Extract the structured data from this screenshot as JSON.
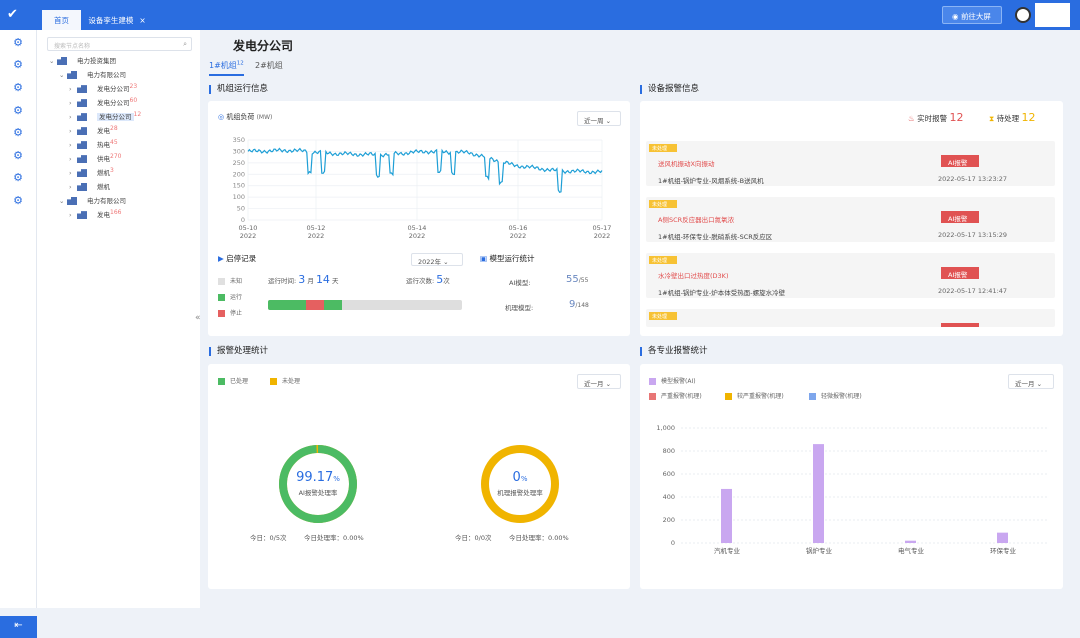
{
  "header": {
    "tabs": [
      {
        "label": "首页"
      },
      {
        "label": "设备孪生建模"
      }
    ],
    "big_screen_label": "前往大屏"
  },
  "tree": {
    "search_placeholder": "搜索节点名称",
    "nodes": [
      {
        "label": "电力投资集团"
      },
      {
        "label": "电力有限公司"
      },
      {
        "label": "发电分公司",
        "count": "23"
      },
      {
        "label": "发电分公司",
        "count": "60"
      },
      {
        "label": "发电分公司",
        "count": "12"
      },
      {
        "label": "发电",
        "count": "28"
      },
      {
        "label": "热电",
        "count": "45"
      },
      {
        "label": "供电",
        "count": "270"
      },
      {
        "label": "燃机",
        "count": "3"
      },
      {
        "label": "燃机",
        "count": ""
      },
      {
        "label": "电力有限公司"
      },
      {
        "label": "发电",
        "count": "166"
      }
    ]
  },
  "page": {
    "title": "发电分公司",
    "unit_tabs": [
      {
        "label": "1#机组",
        "count": "12"
      },
      {
        "label": "2#机组",
        "count": ""
      }
    ]
  },
  "unit_info": {
    "section_title": "机组运行信息",
    "load_label": "机组负荷",
    "load_unit": "(MW)",
    "period_select": "近一周",
    "y_ticks": [
      "350",
      "300",
      "250",
      "200",
      "150",
      "100",
      "50",
      "0"
    ],
    "x_ticks": [
      {
        "date": "05-10",
        "year": "2022"
      },
      {
        "date": "05-12",
        "year": "2022"
      },
      {
        "date": "05-14",
        "year": "2022"
      },
      {
        "date": "05-16",
        "year": "2022"
      },
      {
        "date": "05-17",
        "year": "2022"
      }
    ],
    "startstop": {
      "title": "启停记录",
      "year_select": "2022年",
      "legend": [
        {
          "label": "未知",
          "color": "#e0e0e0"
        },
        {
          "label": "运行",
          "color": "#4cbb63"
        },
        {
          "label": "停止",
          "color": "#e56060"
        }
      ],
      "run_time_label": "运行时间:",
      "run_months": "3",
      "month_unit": "月",
      "run_days": "14",
      "day_unit": "天",
      "run_count_label": "运行次数:",
      "run_count": "5",
      "count_unit": "次"
    },
    "model_stats": {
      "title": "模型运行统计",
      "ai_label": "AI模型:",
      "ai_value": "55",
      "ai_total": "/55",
      "mech_label": "机理模型:",
      "mech_value": "9",
      "mech_total": "/148"
    }
  },
  "alarm_info": {
    "section_title": "设备报警信息",
    "realtime_label": "实时报警",
    "realtime_count": "12",
    "pending_label": "待处理",
    "pending_count": "12",
    "items": [
      {
        "tag": "未处理",
        "title": "送风机振动X向振动",
        "button": "AI报警",
        "path": "1#机组-锅炉专业-风烟系统-B送风机",
        "time": "2022-05-17 13:23:27"
      },
      {
        "tag": "未处理",
        "title": "A侧SCR反应器出口氮氧浓",
        "button": "AI报警",
        "path": "1#机组-环保专业-脱硝系统-SCR反应区",
        "time": "2022-05-17 13:15:29"
      },
      {
        "tag": "未处理",
        "title": "水冷壁出口过热度(D3K)",
        "button": "AI报警",
        "path": "1#机组-锅炉专业-炉本体受热面-螺旋水冷壁",
        "time": "2022-05-17 12:41:47"
      },
      {
        "tag": "未处理",
        "title": "",
        "button": "",
        "path": "",
        "time": ""
      }
    ]
  },
  "alarm_stats": {
    "section_title": "报警处理统计",
    "legend_done": "已处理",
    "legend_undone": "未处理",
    "period_select": "近一月",
    "ai_rate": "99.17",
    "percent": "%",
    "ai_rate_label": "AI报警处理率",
    "ai_today": "今日：0/5次",
    "ai_today_rate": "今日处理率：0.00%",
    "mech_rate": "0",
    "mech_rate_label": "机理报警处理率",
    "mech_today": "今日：0/0次",
    "mech_today_rate": "今日处理率：0.00%"
  },
  "dept_stats": {
    "section_title": "各专业报警统计",
    "period_select": "近一月"
  },
  "colors": {
    "accent": "#2a6de0",
    "run": "#4cbb63",
    "stop": "#e56060",
    "pending": "#f0b400"
  },
  "chart_data": [
    {
      "type": "line",
      "title": "机组负荷",
      "ylabel": "(MW)",
      "ylim": [
        0,
        350
      ],
      "x": [
        "2022-05-10",
        "2022-05-11",
        "2022-05-12",
        "2022-05-13",
        "2022-05-14",
        "2022-05-15",
        "2022-05-16",
        "2022-05-17"
      ],
      "series": [
        {
          "values": [
            300,
            305,
            290,
            285,
            300,
            295,
            240,
            215,
            210
          ]
        }
      ]
    },
    {
      "type": "bar",
      "categories": [
        "汽机专业",
        "锅炉专业",
        "电气专业",
        "环保专业"
      ],
      "ylim": [
        0,
        1000
      ],
      "yticks": [
        "1,000",
        "800",
        "600",
        "400",
        "200",
        "0"
      ],
      "series": [
        {
          "name": "模型报警(AI)",
          "color": "#c9a7f0",
          "values": [
            470,
            860,
            20,
            90
          ]
        },
        {
          "name": "严重报警(机理)",
          "color": "#e87676",
          "values": [
            0,
            0,
            0,
            0
          ]
        },
        {
          "name": "较严重报警(机理)",
          "color": "#f0b400",
          "values": [
            0,
            0,
            0,
            0
          ]
        },
        {
          "name": "轻微报警(机理)",
          "color": "#7ea6ec",
          "values": [
            0,
            0,
            0,
            0
          ]
        }
      ]
    }
  ]
}
